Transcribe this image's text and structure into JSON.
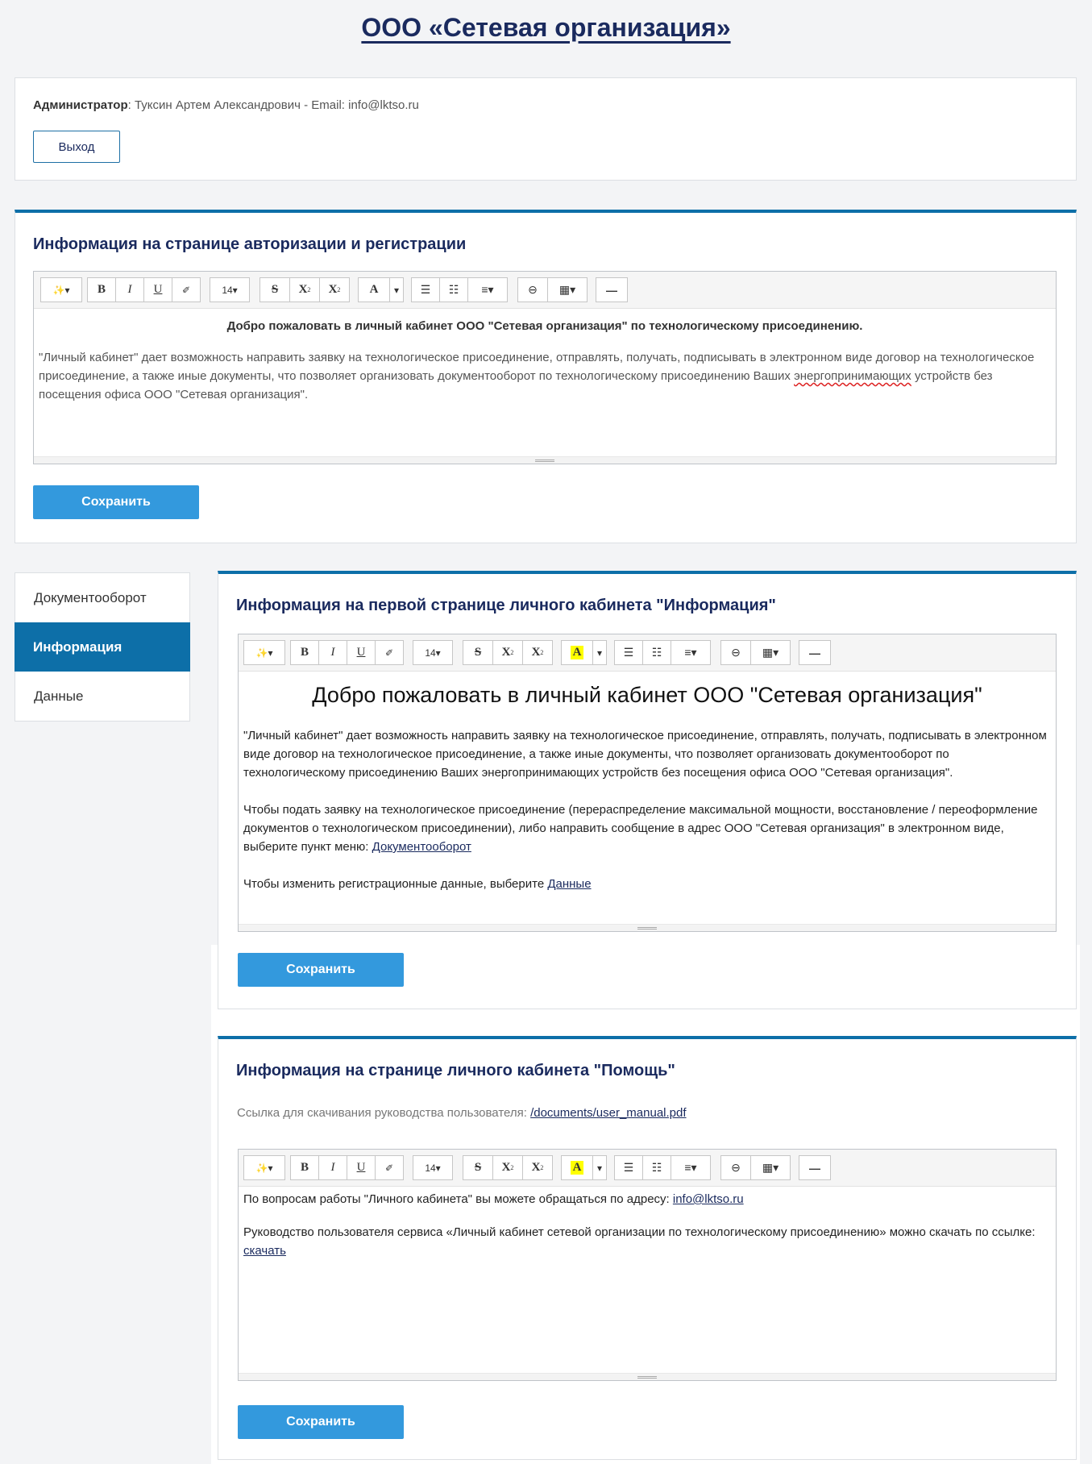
{
  "header": {
    "title": "ООО «Сетевая организация»"
  },
  "admin": {
    "role_label": "Администратор",
    "details": ": Туксин Артем Александрович - Email: info@lktso.ru",
    "logout_label": "Выход"
  },
  "toolbar": {
    "magic": "✨▾",
    "bold": "B",
    "italic": "I",
    "underline": "U",
    "eraser": "✐",
    "fontsize": "14▾",
    "strike": "S",
    "superscript": "X",
    "subscript": "X",
    "color_a": "A",
    "color_caret": "▾",
    "ul": "☰",
    "ol": "☷",
    "align": "≡▾",
    "link": "⊖",
    "table": "▦▾",
    "hr": "—"
  },
  "auth_section": {
    "title": "Информация на странице авторизации и регистрации",
    "welcome": "Добро пожаловать в личный кабинет ООО \"Сетевая организация\" по технологическому присоединению.",
    "body_part1": "\"Личный кабинет\" дает возможность направить заявку на технологическое присоединение, отправлять, получать, подписывать в электронном виде договор на технологическое присоединение, а также иные документы, что позволяет организовать документооборот по технологическому присоединению Ваших ",
    "body_spell": "энергопринимающих",
    "body_part2": " устройств без посещения офиса ООО \"Сетевая организация\".",
    "save_label": "Сохранить"
  },
  "nav": {
    "items": [
      {
        "label": "Документооборот"
      },
      {
        "label": "Информация"
      },
      {
        "label": "Данные"
      }
    ]
  },
  "info_section": {
    "title": "Информация на первой странице личного кабинета \"Информация\"",
    "heading": "Добро пожаловать в личный кабинет ООО \"Сетевая организация\"",
    "para1": "\"Личный кабинет\" дает возможность направить заявку на технологическое присоединение, отправлять, получать, подписывать в электронном виде договор на технологическое присоединение, а также иные документы, что позволяет организовать документооборот по технологическому присоединению Ваших энергопринимающих устройств без посещения офиса ООО \"Сетевая организация\".",
    "para2": "Чтобы подать заявку на технологическое присоединение (перераспределение максимальной мощности, восстановление / переоформление документов о технологическом присоединении), либо направить сообщение в адрес ООО \"Сетевая организация\" в электронном виде, выберите пункт меню: ",
    "para2_link": "Документооборот",
    "para3": "Чтобы изменить регистрационные данные, выберите ",
    "para3_link": "Данные",
    "save_label": "Сохранить"
  },
  "help_section": {
    "title": "Информация на странице личного кабинета \"Помощь\"",
    "manual_label": "Ссылка для скачивания руководства пользователя: ",
    "manual_link": "/documents/user_manual.pdf",
    "line1": "По вопросам работы \"Личного кабинета\" вы можете обращаться по адресу: ",
    "line1_link": "info@lktso.ru",
    "line2": "Руководство пользователя сервиса «Личный кабинет сетевой организации по технологическому присоединению» можно скачать по ссылке: ",
    "line2_link": "скачать",
    "save_label": "Сохранить"
  },
  "colors": {
    "accent": "#0d6fa8",
    "button": "#3399dd",
    "title": "#1a2a5e",
    "highlight": "#ffff00"
  }
}
